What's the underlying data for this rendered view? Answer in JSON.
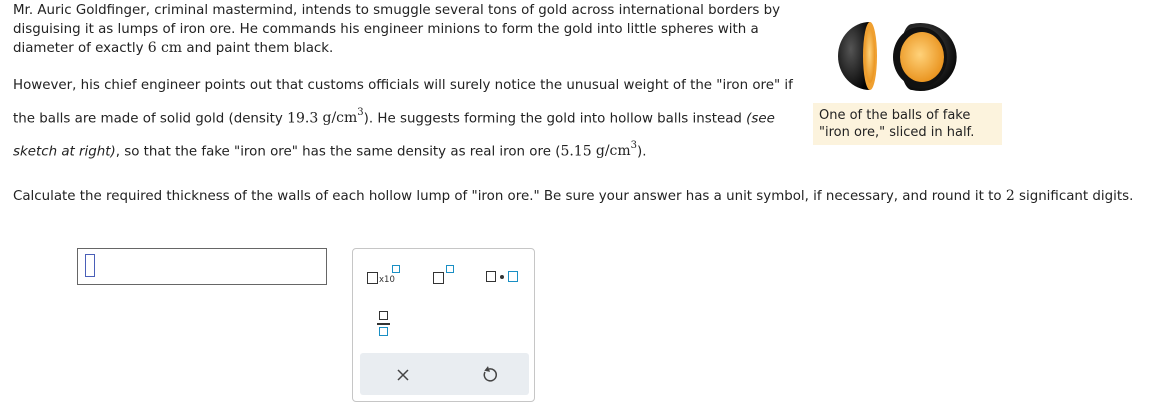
{
  "problem": {
    "intro": "Mr. Auric Goldfinger, criminal mastermind, intends to smuggle several tons of gold across international borders by disguising it as lumps of iron ore. He commands his engineer minions to form the gold into little spheres with a diameter of exactly",
    "diameter_value": "6",
    "diameter_unit": "cm",
    "intro_end": "and paint them black.",
    "para2_a": "However, his chief engineer points out that customs officials will surely notice the unusual weight of the \"iron ore\" if the balls are made of solid gold (density",
    "gold_density": "19.3",
    "density_unit": "g/cm",
    "density_exp": "3",
    "para2_b": "). He suggests forming the gold into hollow balls instead",
    "para2_italic": "(see sketch at right)",
    "para2_c": ", so that the fake \"iron ore\" has the same density as real iron ore (",
    "iron_density": "5.15",
    "para2_d": ").",
    "question_a": "Calculate the required thickness of the walls of each hollow lump of \"iron ore.\" Be sure your answer has a unit symbol, if necessary, and round it to",
    "sig_figs": "2",
    "question_b": "significant digits."
  },
  "figure": {
    "caption": "One of the balls of fake \"iron ore,\" sliced in half.",
    "colors": {
      "shell": "#111111",
      "inner": "#f5a623",
      "inner_light": "#ffd27a",
      "caption_bg": "#fcf3dd"
    }
  },
  "answer": {
    "value": ""
  },
  "palette": {
    "sci_notation_label": "x10",
    "colors": {
      "box_dark": "#333333",
      "box_accent": "#1a8fc4"
    }
  }
}
